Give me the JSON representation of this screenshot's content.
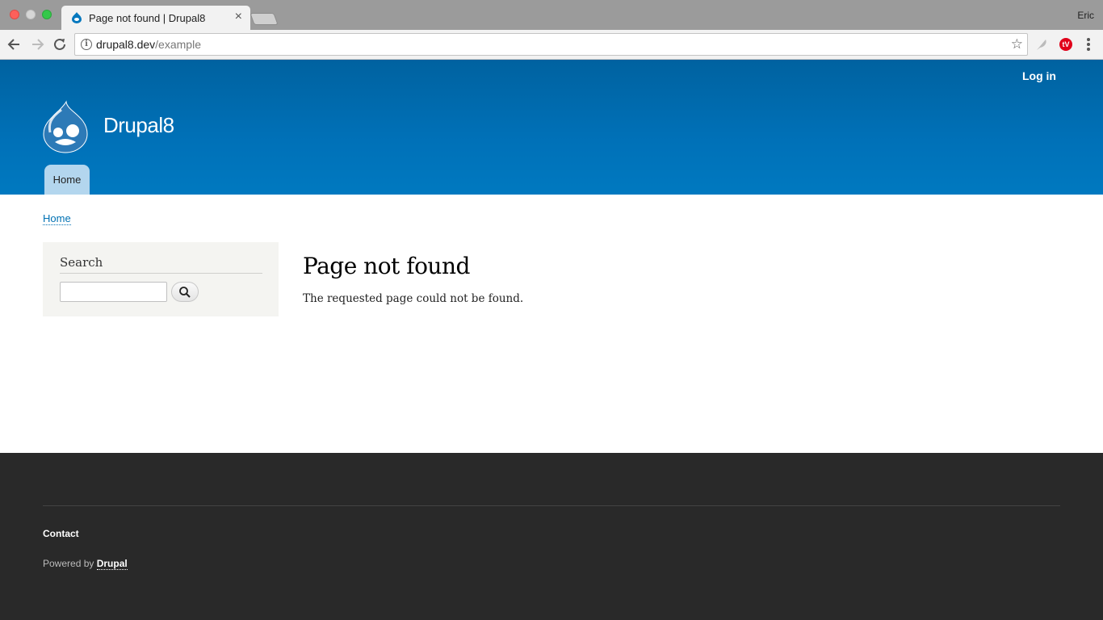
{
  "browser": {
    "tab_title": "Page not found | Drupal8",
    "tab_close": "×",
    "profile_name": "Eric",
    "url_domain": "drupal8.dev",
    "url_path": "/example",
    "star": "☆",
    "ext2_label": "tV",
    "info_glyph": "i"
  },
  "header": {
    "login_label": "Log in",
    "site_name": "Drupal8",
    "nav": [
      {
        "label": "Home"
      }
    ]
  },
  "breadcrumb": {
    "items": [
      {
        "label": "Home"
      }
    ]
  },
  "sidebar": {
    "search_title": "Search",
    "search_value": ""
  },
  "main": {
    "title": "Page not found",
    "message": "The requested page could not be found."
  },
  "footer": {
    "contact_label": "Contact",
    "powered_by_prefix": "Powered by ",
    "powered_by_link": "Drupal"
  },
  "colors": {
    "header_blue": "#0071b8",
    "link_blue": "#0071b3",
    "footer_bg": "#292929",
    "nav_tab": "#b3d6ee"
  }
}
